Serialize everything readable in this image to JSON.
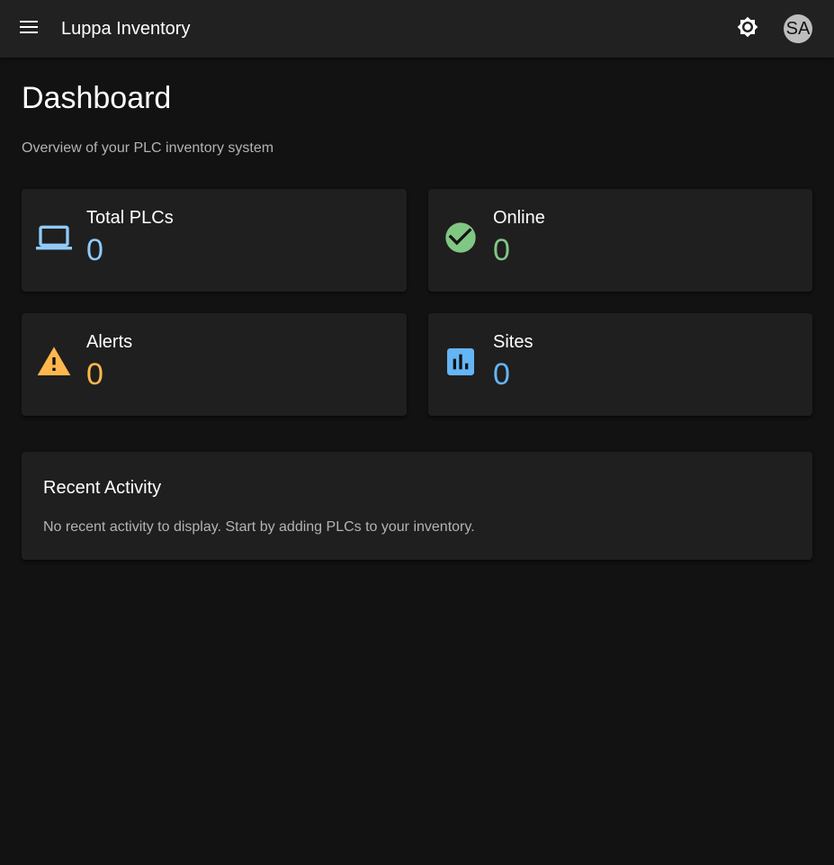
{
  "appbar": {
    "title": "Luppa Inventory",
    "menu_icon": "menu-icon",
    "theme_icon": "brightness-icon",
    "avatar_initials": "SA"
  },
  "page": {
    "title": "Dashboard",
    "subtitle": "Overview of your PLC inventory system"
  },
  "stats": [
    {
      "label": "Total PLCs",
      "value": "0",
      "icon": "laptop-icon",
      "color": "#90caf9"
    },
    {
      "label": "Online",
      "value": "0",
      "icon": "check-circle-icon",
      "color": "#81c784"
    },
    {
      "label": "Alerts",
      "value": "0",
      "icon": "warning-icon",
      "color": "#ffb74d"
    },
    {
      "label": "Sites",
      "value": "0",
      "icon": "bar-chart-icon",
      "color": "#64b5f6"
    }
  ],
  "recent_activity": {
    "title": "Recent Activity",
    "empty_text": "No recent activity to display. Start by adding PLCs to your inventory."
  },
  "theme": {
    "background": "#121212",
    "surface": "#1f1f1f",
    "appbar": "#212121"
  }
}
